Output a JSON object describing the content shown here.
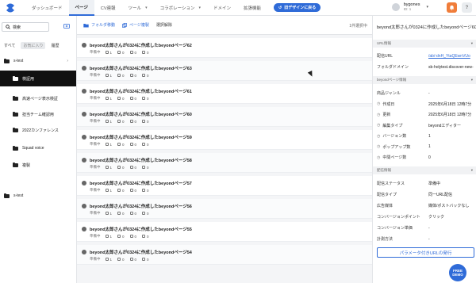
{
  "header": {
    "nav": [
      {
        "label": "ダッシュボード",
        "has_menu": false
      },
      {
        "label": "ページ",
        "has_menu": false,
        "active": true
      },
      {
        "label": "CV連報",
        "has_menu": false
      },
      {
        "label": "ツール",
        "has_menu": true
      },
      {
        "label": "コラボレーション",
        "has_menu": true
      },
      {
        "label": "ドメイン",
        "has_menu": false
      },
      {
        "label": "拡張機能",
        "has_menu": false
      }
    ],
    "redesign_label": "旧デザインに戻る",
    "user_name": "bygones",
    "user_id": "ID: 1",
    "notification_icon": "bell-icon",
    "help_icon": "question-icon",
    "accent": "#2f6bd8",
    "notify_color": "#f07d3a"
  },
  "sidebar": {
    "search_label": "検索",
    "filter_tabs": [
      "すべて",
      "お気に入り",
      "履歴"
    ],
    "tree": [
      {
        "label": "s-test",
        "level": 0,
        "active": false
      },
      {
        "label": "検証用",
        "level": 1,
        "active": true
      },
      {
        "label": "高速ページ表示検証",
        "level": 1,
        "active": false
      },
      {
        "label": "担当チーム確認用",
        "level": 1,
        "active": false
      },
      {
        "label": "2022カンファレンス",
        "level": 1,
        "active": false
      },
      {
        "label": "Squad voice",
        "level": 1,
        "active": false
      },
      {
        "label": "複製",
        "level": 1,
        "active": false
      },
      {
        "label": "s-test",
        "level": 0,
        "active": false
      }
    ]
  },
  "toolbar": {
    "move_label": "フォルダ移動",
    "duplicate_label": "ページ複製",
    "deselect_label": "選択解除",
    "selected_count": "1件選択中"
  },
  "pages": [
    {
      "title": "beyond太郎さんが0324に作成したbeyondページ62",
      "status": "準備中",
      "counts": [
        "1",
        "0",
        "0",
        "0"
      ]
    },
    {
      "title": "beyond太郎さんが0324に作成したbeyondページ63",
      "status": "準備中",
      "counts": [
        "1",
        "0",
        "0",
        "0"
      ]
    },
    {
      "title": "beyond太郎さんが0324に作成したbeyondページ61",
      "status": "準備中",
      "counts": [
        "1",
        "0",
        "0",
        "0"
      ]
    },
    {
      "title": "beyond太郎さんが0324に作成したbeyondページ60",
      "status": "準備中",
      "counts": [
        "1",
        "0",
        "0",
        "0"
      ]
    },
    {
      "title": "beyond太郎さんが0324に作成したbeyondページ59",
      "status": "準備中",
      "counts": [
        "1",
        "0",
        "0",
        "0"
      ]
    },
    {
      "title": "beyond太郎さんが0324に作成したbeyondページ58",
      "status": "準備中",
      "counts": [
        "1",
        "0",
        "0",
        "0"
      ]
    },
    {
      "title": "beyond太郎さんが0324に作成したbeyondページ57",
      "status": "準備中",
      "counts": [
        "1",
        "0",
        "0",
        "0"
      ]
    },
    {
      "title": "beyond太郎さんが0324に作成したbeyondページ56",
      "status": "準備中",
      "counts": [
        "1",
        "0",
        "0",
        "0"
      ]
    },
    {
      "title": "beyond太郎さんが0324に作成したbeyondページ55",
      "status": "準備中",
      "counts": [
        "1",
        "0",
        "0",
        "0"
      ]
    },
    {
      "title": "beyond太郎さんが0324に作成したbeyondページ54",
      "status": "準備中",
      "counts": [
        "1",
        "0",
        "0",
        "0"
      ]
    }
  ],
  "detail": {
    "title": "beyond太郎さんが0324に作成したbeyondページ60",
    "sections": {
      "url": "URL情報",
      "page": "beyondページ情報",
      "delivery": "配信情報"
    },
    "url_rows": [
      {
        "label": "配信URL",
        "value": "/ab/-dnH_YtaQEwnVUo",
        "link": true
      },
      {
        "label": "フォルダドメイン",
        "value": "sb-holytest.discover-new-",
        "link": false
      }
    ],
    "page_rows": [
      {
        "label": "商品ジャンル",
        "value": "-"
      },
      {
        "label": "作成日",
        "value": "2025年6月18日 12時7分"
      },
      {
        "label": "更新",
        "value": "2025年6月18日 12時7分"
      },
      {
        "label": "編集タイプ",
        "value": "beyondエディター"
      },
      {
        "label": "バージョン数",
        "value": "1"
      },
      {
        "label": "ポップアップ数",
        "value": "1"
      },
      {
        "label": "中間ページ数",
        "value": "0"
      }
    ],
    "delivery_rows": [
      {
        "label": "配信ステータス",
        "value": "準備中"
      },
      {
        "label": "配信タイプ",
        "value": "同一URL配信"
      },
      {
        "label": "広告媒体",
        "value": "媒体/ポストバックなし"
      },
      {
        "label": "コンバージョンポイント",
        "value": "クリック"
      },
      {
        "label": "コンバージョン単価",
        "value": "-"
      },
      {
        "label": "計測方法",
        "value": "-"
      }
    ],
    "param_button": "パラメータ付きURLの発行"
  },
  "free_badge": "FREE\nDEMO"
}
